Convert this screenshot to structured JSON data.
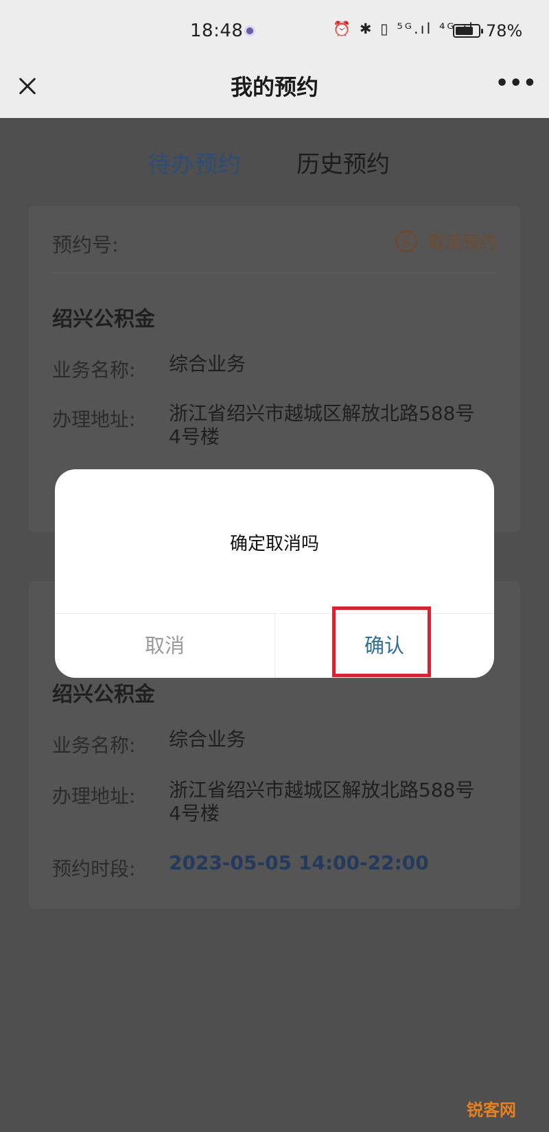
{
  "status_bar": {
    "time": "18:48",
    "icons": "⏰ ✱ ▯ ⁵ᴳ.ıl ⁴ᴳ.ıl",
    "battery_level": 0.78,
    "battery_text": "78%"
  },
  "nav": {
    "title": "我的预约",
    "close_icon": "close-icon",
    "more_icon": "more-icon"
  },
  "tabs": [
    {
      "label": "待办预约",
      "active": true,
      "color": "#2d4d77"
    },
    {
      "label": "历史预约",
      "active": false
    }
  ],
  "card1": {
    "number_label": "预约号:",
    "cancel_label": "取消预约",
    "org": "绍兴公积金",
    "business_label": "业务名称:",
    "business_value": "综合业务",
    "address_label": "办理地址:",
    "address_line1": "浙江省绍兴市越城区解放北路588号",
    "address_line2": "4号楼"
  },
  "card2": {
    "org": "绍兴公积金",
    "business_label": "业务名称:",
    "business_value": "综合业务",
    "address_label": "办理地址:",
    "address_line1": "浙江省绍兴市越城区解放北路588号",
    "address_line2": "4号楼",
    "time_label": "预约时段:",
    "time_value": "2023-05-05 14:00-22:00"
  },
  "dialog": {
    "message": "确定取消吗",
    "cancel_label": "取消",
    "confirm_label": "确认",
    "confirm_color": "#2f6e95",
    "highlight_color": "#d9232e"
  },
  "watermark": "锐客网"
}
